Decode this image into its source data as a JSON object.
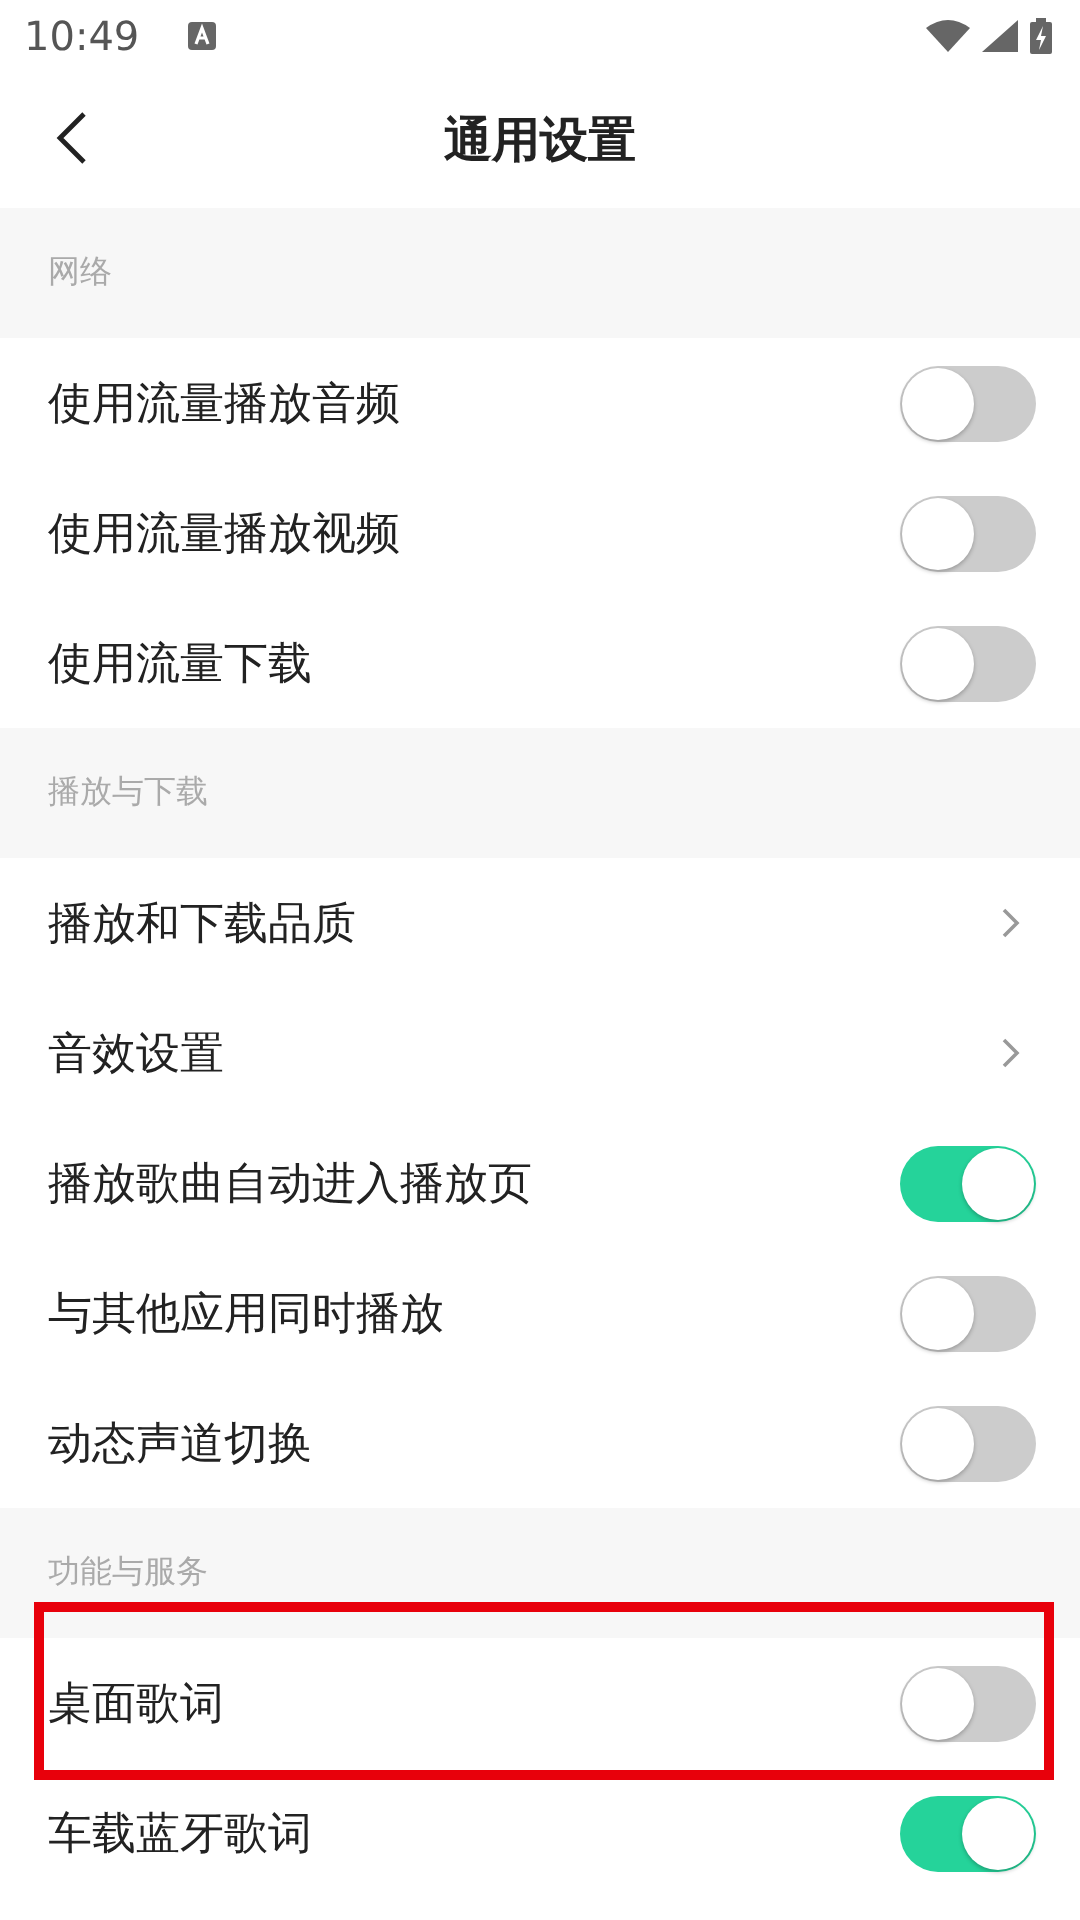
{
  "status_bar": {
    "time": "10:49"
  },
  "header": {
    "title": "通用设置"
  },
  "sections": [
    {
      "title": "网络",
      "items": [
        {
          "kind": "toggle",
          "label": "使用流量播放音频",
          "on": false,
          "highlighted": false
        },
        {
          "kind": "toggle",
          "label": "使用流量播放视频",
          "on": false,
          "highlighted": false
        },
        {
          "kind": "toggle",
          "label": "使用流量下载",
          "on": false,
          "highlighted": false
        }
      ]
    },
    {
      "title": "播放与下载",
      "items": [
        {
          "kind": "link",
          "label": "播放和下载品质",
          "highlighted": false
        },
        {
          "kind": "link",
          "label": "音效设置",
          "highlighted": false
        },
        {
          "kind": "toggle",
          "label": "播放歌曲自动进入播放页",
          "on": true,
          "highlighted": false
        },
        {
          "kind": "toggle",
          "label": "与其他应用同时播放",
          "on": false,
          "highlighted": false
        },
        {
          "kind": "toggle",
          "label": "动态声道切换",
          "on": false,
          "highlighted": false
        }
      ]
    },
    {
      "title": "功能与服务",
      "items": [
        {
          "kind": "toggle",
          "label": "桌面歌词",
          "on": false,
          "highlighted": true
        },
        {
          "kind": "toggle",
          "label": "车载蓝牙歌词",
          "on": true,
          "highlighted": false
        }
      ]
    }
  ]
}
